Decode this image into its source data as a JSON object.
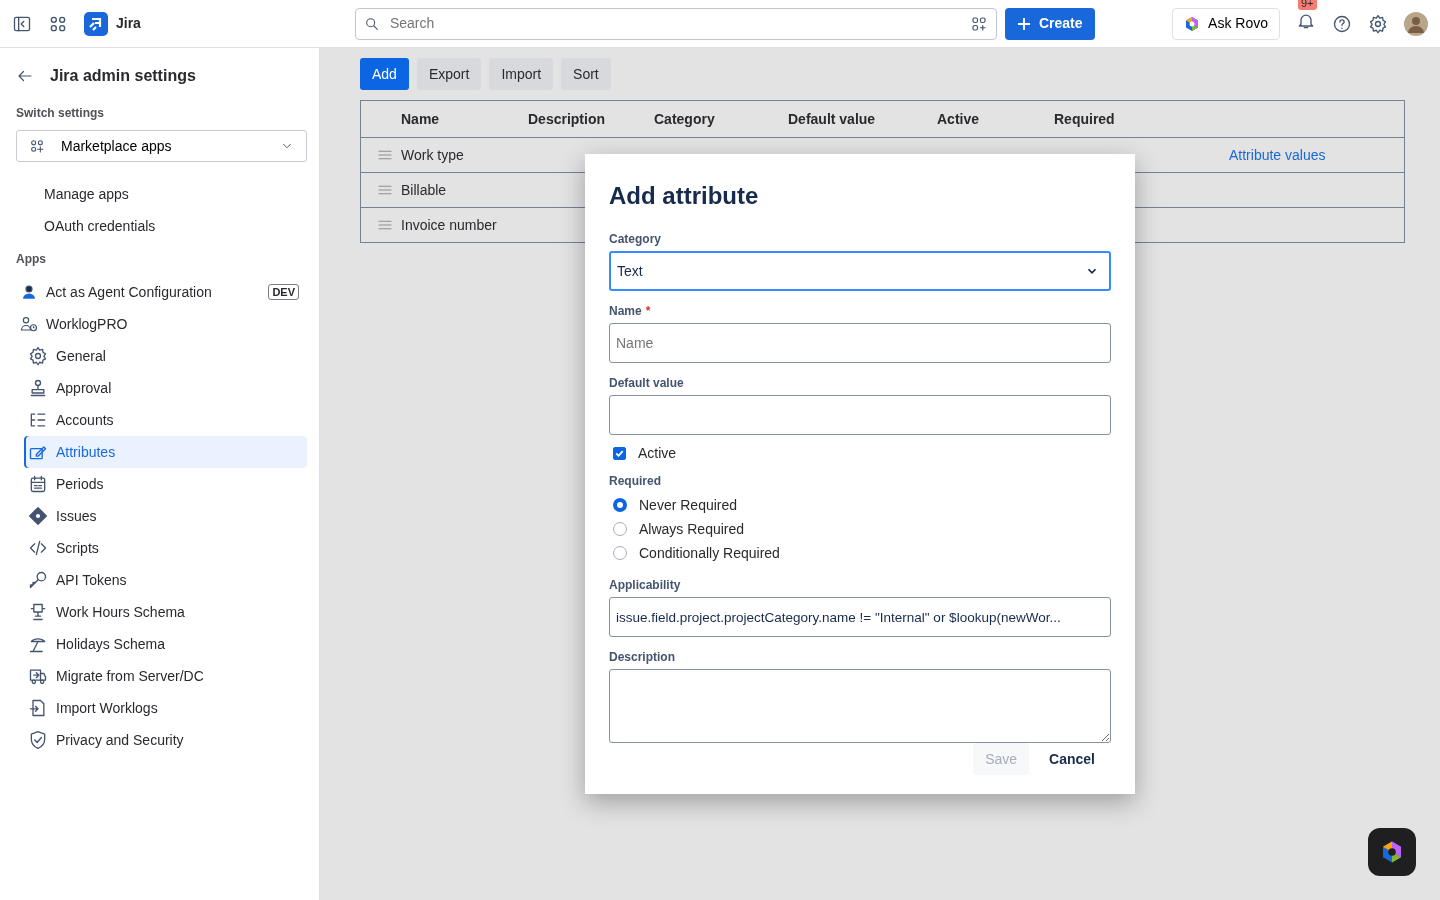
{
  "topbar": {
    "product": "Jira",
    "search_placeholder": "Search",
    "create": "Create",
    "ask_rovo": "Ask Rovo",
    "notifications": "9+"
  },
  "sidebar": {
    "title": "Jira admin settings",
    "switch_label": "Switch settings",
    "switch_value": "Marketplace apps",
    "links": [
      {
        "label": "Manage apps",
        "selected": false
      },
      {
        "label": "OAuth credentials",
        "selected": false
      }
    ],
    "apps_label": "Apps",
    "apps": [
      {
        "label": "Act as Agent Configuration",
        "badge": "DEV",
        "selected": false
      },
      {
        "label": "WorklogPRO",
        "selected": false,
        "children": [
          {
            "label": "General",
            "selected": false
          },
          {
            "label": "Approval",
            "selected": false
          },
          {
            "label": "Accounts",
            "selected": false
          },
          {
            "label": "Attributes",
            "selected": true
          },
          {
            "label": "Periods",
            "selected": false
          },
          {
            "label": "Issues",
            "selected": false
          },
          {
            "label": "Scripts",
            "selected": false
          },
          {
            "label": "API Tokens",
            "selected": false
          },
          {
            "label": "Work Hours Schema",
            "selected": false
          },
          {
            "label": "Holidays Schema",
            "selected": false
          },
          {
            "label": "Migrate from Server/DC",
            "selected": false
          },
          {
            "label": "Import Worklogs",
            "selected": false
          },
          {
            "label": "Privacy and Security",
            "selected": false
          }
        ]
      }
    ]
  },
  "toolbar": [
    {
      "label": "Add",
      "kind": "primary"
    },
    {
      "label": "Export",
      "kind": "default"
    },
    {
      "label": "Import",
      "kind": "default"
    },
    {
      "label": "Sort",
      "kind": "default"
    }
  ],
  "table": {
    "columns": [
      "Name",
      "Description",
      "Category",
      "Default value",
      "Active",
      "Required"
    ],
    "rows": [
      {
        "name": "Work type",
        "link": "Attribute values"
      },
      {
        "name": "Billable"
      },
      {
        "name": "Invoice number"
      }
    ]
  },
  "dialog": {
    "title": "Add attribute",
    "category_label": "Category",
    "category_value": "Text",
    "name_label": "Name",
    "name_required_mark": "*",
    "name_placeholder": "Name",
    "default_label": "Default value",
    "active_label": "Active",
    "active_checked": true,
    "required_label": "Required",
    "required_options": [
      {
        "label": "Never Required",
        "selected": true
      },
      {
        "label": "Always Required",
        "selected": false
      },
      {
        "label": "Conditionally Required",
        "selected": false
      }
    ],
    "applicability_label": "Applicability",
    "applicability_value": "issue.field.project.projectCategory.name != \"Internal\" or $lookup(newWor...",
    "description_label": "Description",
    "save": "Save",
    "save_disabled": true,
    "cancel": "Cancel"
  }
}
